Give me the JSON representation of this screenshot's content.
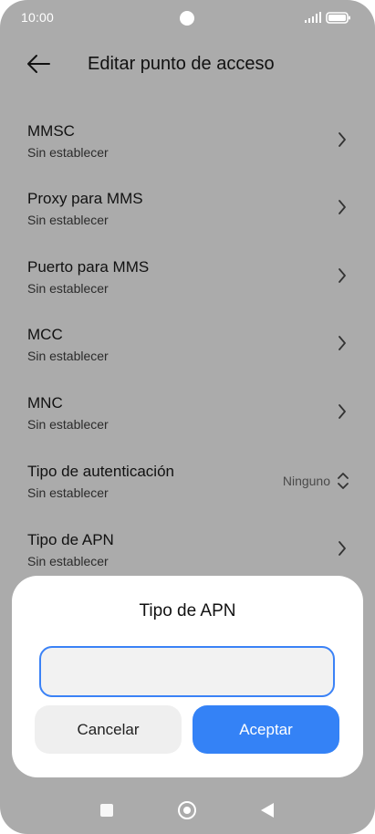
{
  "status_bar": {
    "time": "10:00"
  },
  "header": {
    "title": "Editar punto de acceso",
    "back_icon": "arrow-left-icon"
  },
  "settings": {
    "items": [
      {
        "title": "MMSC",
        "subtitle": "Sin establecer"
      },
      {
        "title": "Proxy para MMS",
        "subtitle": "Sin establecer"
      },
      {
        "title": "Puerto para MMS",
        "subtitle": "Sin establecer"
      },
      {
        "title": "MCC",
        "subtitle": "Sin establecer"
      },
      {
        "title": "MNC",
        "subtitle": "Sin establecer"
      },
      {
        "title": "Tipo de autenticación",
        "subtitle": "Sin establecer",
        "value": "Ninguno"
      },
      {
        "title": "Tipo de APN",
        "subtitle": "Sin establecer"
      }
    ]
  },
  "dialog": {
    "title": "Tipo de APN",
    "input_value": "",
    "cancel_label": "Cancelar",
    "accept_label": "Aceptar"
  },
  "colors": {
    "accent": "#3482f6",
    "overlay_background": "#ababab",
    "dialog_background": "#ffffff"
  }
}
